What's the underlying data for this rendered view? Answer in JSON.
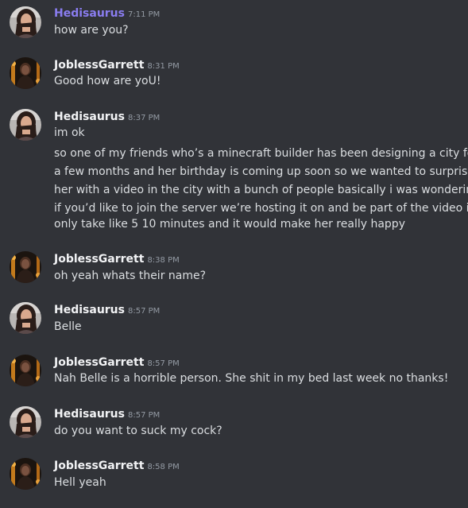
{
  "colors": {
    "background": "#313338",
    "accent_username": "#8a7df0",
    "username": "#f2f3f5",
    "timestamp": "#949ba4",
    "message_text": "#dbdee1"
  },
  "messages": [
    {
      "author": "Hedisaurus",
      "time": "7:11 PM",
      "avatar": "female-avatar",
      "lines": [
        "how are you?"
      ]
    },
    {
      "author": "JoblessGarrett",
      "time": "8:31 PM",
      "avatar": "dark-avatar",
      "lines": [
        "Good how are yoU!"
      ]
    },
    {
      "author": "Hedisaurus",
      "time": "8:37 PM",
      "avatar": "female-avatar",
      "lines": [
        "im ok"
      ]
    },
    {
      "lines": [
        "so one of my friends who’s a minecraft builder has been designing a city for",
        "a few months and her birthday is coming up soon so we wanted to surprise",
        "her with a video in the city with a bunch of people basically i was wondering",
        "if you’d like to join the server we’re hosting it on and be part of the video it’ll",
        "only take like 5 10 minutes and it would make her really happy"
      ]
    },
    {
      "author": "JoblessGarrett",
      "time": "8:38 PM",
      "avatar": "dark-avatar",
      "lines": [
        "oh yeah whats their name?"
      ]
    },
    {
      "author": "Hedisaurus",
      "time": "8:57 PM",
      "avatar": "female-avatar",
      "lines": [
        "Belle"
      ]
    },
    {
      "author": "JoblessGarrett",
      "time": "8:57 PM",
      "avatar": "dark-avatar",
      "lines": [
        "Nah Belle is a horrible person. She shit in my bed last week no thanks!"
      ]
    },
    {
      "author": "Hedisaurus",
      "time": "8:57 PM",
      "avatar": "female-avatar",
      "lines": [
        "do you want to suck my cock?"
      ]
    },
    {
      "author": "JoblessGarrett",
      "time": "8:58 PM",
      "avatar": "dark-avatar",
      "lines": [
        "Hell yeah"
      ]
    }
  ]
}
